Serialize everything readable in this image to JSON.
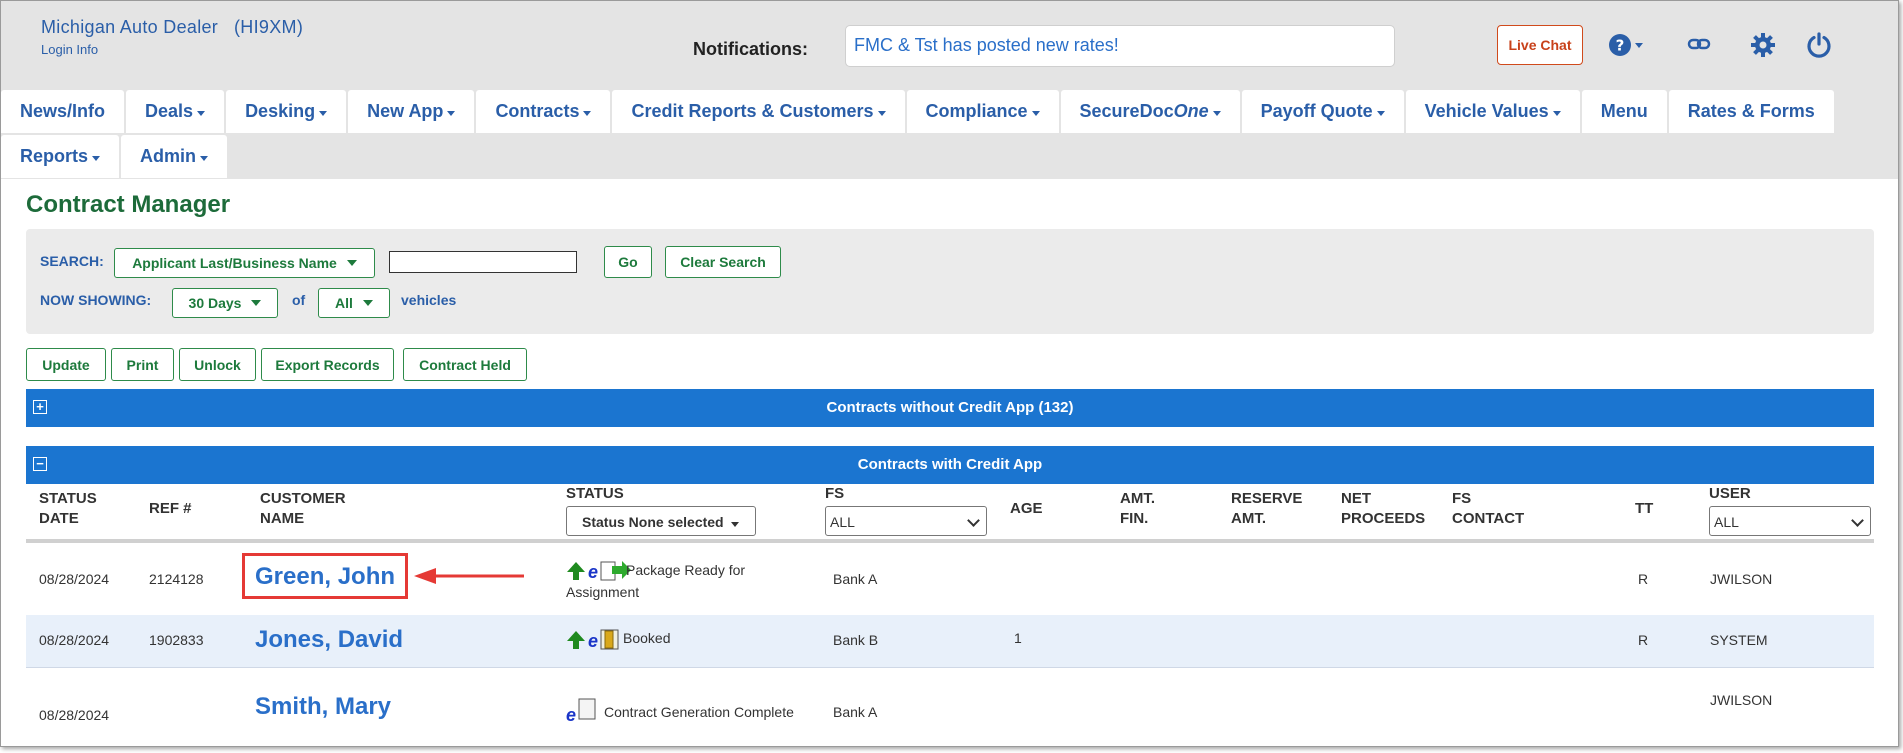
{
  "header": {
    "dealer_name": "Michigan  Auto  Dealer",
    "dealer_code": "(HI9XM)",
    "login_info": "Login  Info",
    "notifications_label": "Notifications:",
    "notification_text": "FMC & Tst has posted new rates!",
    "live_chat": "Live Chat",
    "icons": [
      "help-icon",
      "link-icon",
      "gear-icon",
      "power-icon"
    ]
  },
  "nav": {
    "row1": [
      {
        "label": "News/Info",
        "caret": false
      },
      {
        "label": "Deals",
        "caret": true
      },
      {
        "label": "Desking",
        "caret": true
      },
      {
        "label": "New App",
        "caret": true
      },
      {
        "label": "Contracts",
        "caret": true
      },
      {
        "label": "Credit Reports & Customers",
        "caret": true
      },
      {
        "label": "Compliance",
        "caret": true
      },
      {
        "label": "SecureDocOne",
        "caret": true
      },
      {
        "label": "Payoff Quote",
        "caret": true
      },
      {
        "label": "Vehicle Values",
        "caret": true
      },
      {
        "label": "Menu",
        "caret": false
      },
      {
        "label": "Rates & Forms",
        "caret": false
      }
    ],
    "row2": [
      {
        "label": "Reports",
        "caret": true
      },
      {
        "label": "Admin",
        "caret": true
      }
    ]
  },
  "page_title": "Contract Manager",
  "search": {
    "label": "SEARCH:",
    "field_select": "Applicant Last/Business Name",
    "input_value": "",
    "go": "Go",
    "clear": "Clear Search",
    "showing_label": "NOW SHOWING:",
    "days_select": "30 Days",
    "of": "of",
    "vehicles_select": "All",
    "vehicles": "vehicles"
  },
  "actions": [
    "Update",
    "Print",
    "Unlock",
    "Export Records",
    "Contract Held"
  ],
  "sections": {
    "without_credit_app": "Contracts without Credit App (132)",
    "with_credit_app": "Contracts with Credit App"
  },
  "columns": {
    "status_date": [
      "STATUS",
      "DATE"
    ],
    "ref": "REF #",
    "customer_name": [
      "CUSTOMER",
      "NAME"
    ],
    "status": "STATUS",
    "status_filter": "Status None selected",
    "fs": "FS",
    "fs_filter": "ALL",
    "age": "AGE",
    "amt_fin": [
      "AMT.",
      "FIN."
    ],
    "reserve_amt": [
      "RESERVE",
      "AMT."
    ],
    "net_proceeds": [
      "NET",
      "PROCEEDS"
    ],
    "fs_contact": [
      "FS",
      "CONTACT"
    ],
    "tt": "TT",
    "user": "USER",
    "user_filter": "ALL"
  },
  "rows": [
    {
      "date": "08/28/2024",
      "ref": "2124128",
      "name": "Green, John",
      "status_line1": "Package Ready for",
      "status_line2": "Assignment",
      "fs": "Bank A",
      "age": "",
      "tt": "R",
      "user": "JWILSON",
      "highlighted": true
    },
    {
      "date": "08/28/2024",
      "ref": "1902833",
      "name": "Jones, David",
      "status_line1": "Booked",
      "status_line2": "",
      "fs": "Bank B",
      "age": "1",
      "tt": "R",
      "user": "SYSTEM",
      "highlighted": false
    },
    {
      "date": "08/28/2024",
      "ref": "",
      "name": "Smith, Mary",
      "status_line1": "Contract Generation Complete",
      "status_line2": "",
      "fs": "Bank A",
      "age": "",
      "tt": "",
      "user": "JWILSON",
      "highlighted": false
    }
  ],
  "colors": {
    "brand_blue": "#2a5ea8",
    "section_bar": "#1b75d0",
    "green": "#1d7a3c",
    "callout_red": "#e53935"
  }
}
